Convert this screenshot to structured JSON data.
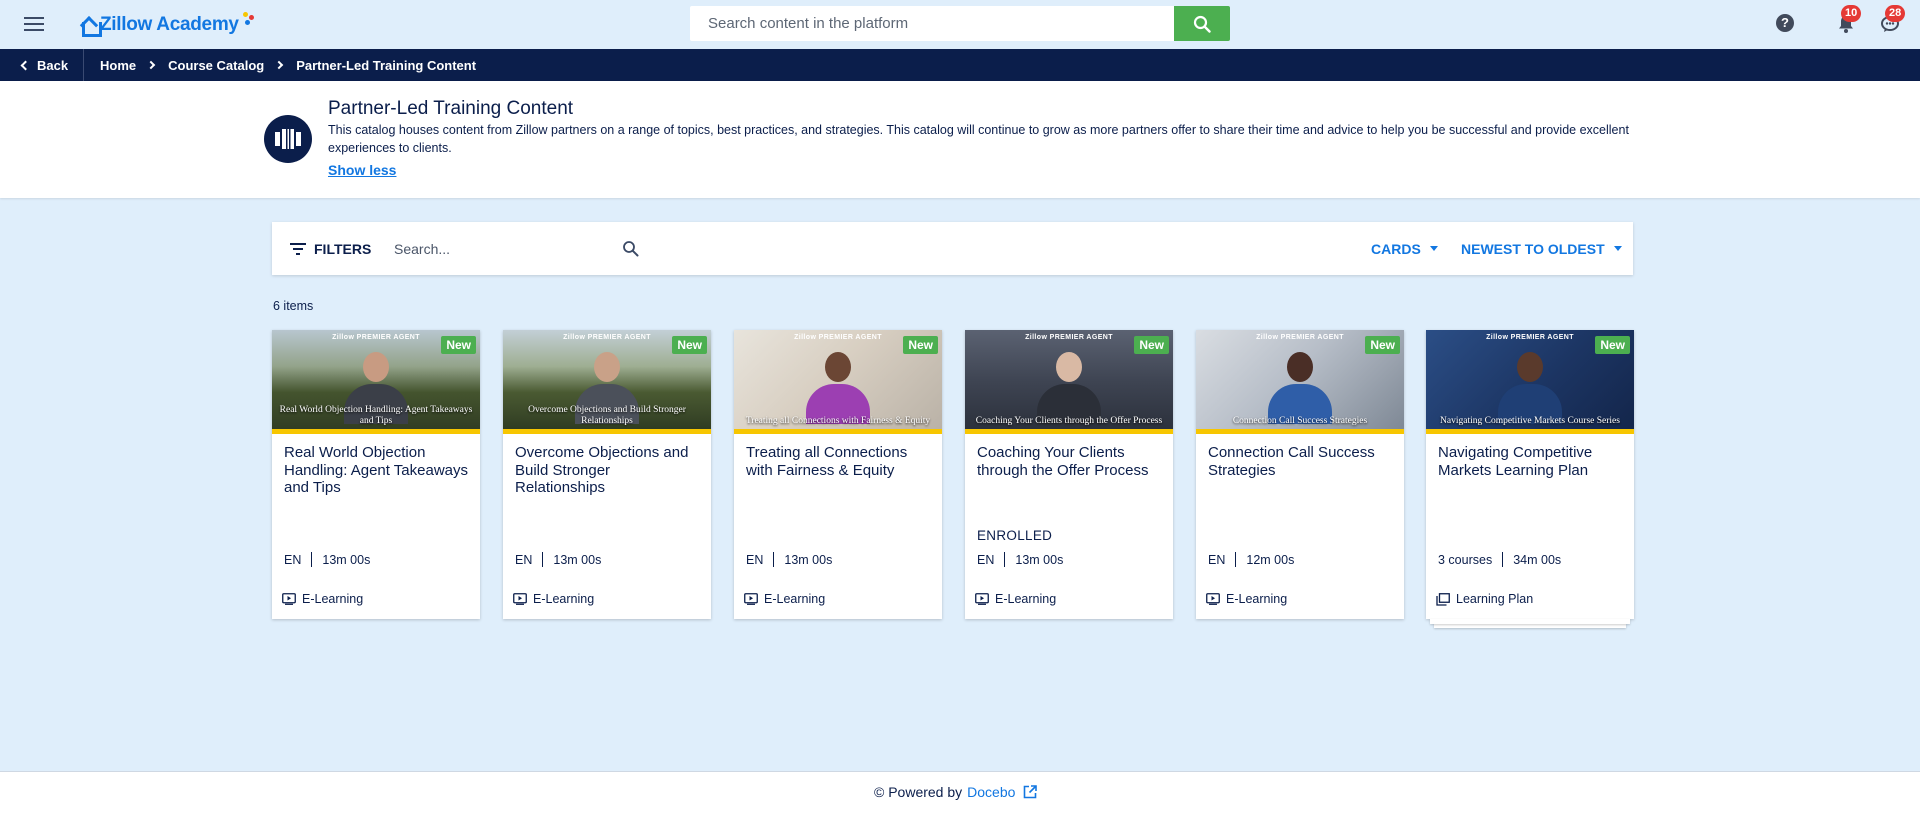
{
  "header": {
    "logo_text": "Zillow Academy",
    "search_placeholder": "Search content in the platform",
    "help_glyph": "?",
    "notifications_count": "10",
    "messages_count": "28",
    "icons": [
      "menu-icon",
      "search-icon",
      "help-icon",
      "bell-icon",
      "chat-icon"
    ]
  },
  "breadcrumb": {
    "back_label": "Back",
    "items": [
      "Home",
      "Course Catalog",
      "Partner-Led Training Content"
    ]
  },
  "catalog": {
    "title": "Partner-Led Training Content",
    "description": "This catalog houses content from Zillow partners on a range of topics, best practices, and strategies. This catalog will continue to grow as more partners offer to share their time and advice to help you be successful and provide excellent experiences to clients.",
    "toggle_label": "Show less"
  },
  "toolbar": {
    "filters_label": "FILTERS",
    "search_placeholder": "Search...",
    "view_label": "CARDS",
    "sort_label": "NEWEST TO OLDEST"
  },
  "results": {
    "count_label": "6 items"
  },
  "cards": [
    {
      "brand": "Zillow PREMIER AGENT",
      "caption": "Real World Objection Handling: Agent Takeaways and Tips",
      "badge": "New",
      "title": "Real World Objection Handling: Agent Takeaways and Tips",
      "meta_left": "EN",
      "meta_right": "13m 00s",
      "status": "",
      "type": "E-Learning"
    },
    {
      "brand": "Zillow PREMIER AGENT",
      "caption": "Overcome Objections and Build Stronger Relationships",
      "badge": "New",
      "title": "Overcome Objections and Build Stronger Relationships",
      "meta_left": "EN",
      "meta_right": "13m 00s",
      "status": "",
      "type": "E-Learning"
    },
    {
      "brand": "Zillow PREMIER AGENT",
      "caption": "Treating all Connections with Fairness & Equity",
      "badge": "New",
      "title": "Treating all Connections with Fairness & Equity",
      "meta_left": "EN",
      "meta_right": "13m 00s",
      "status": "",
      "type": "E-Learning"
    },
    {
      "brand": "Zillow PREMIER AGENT",
      "caption": "Coaching Your Clients through the Offer Process",
      "badge": "New",
      "title": "Coaching Your Clients through the Offer Process",
      "meta_left": "EN",
      "meta_right": "13m 00s",
      "status": "ENROLLED",
      "type": "E-Learning"
    },
    {
      "brand": "Zillow PREMIER AGENT",
      "caption": "Connection Call Success Strategies",
      "badge": "New",
      "title": "Connection Call Success Strategies",
      "meta_left": "EN",
      "meta_right": "12m 00s",
      "status": "",
      "type": "E-Learning"
    },
    {
      "brand": "Zillow PREMIER AGENT",
      "caption": "Navigating Competitive Markets Course Series",
      "badge": "New",
      "title": "Navigating Competitive Markets Learning Plan",
      "meta_left": "3 courses",
      "meta_right": "34m 00s",
      "status": "",
      "type": "Learning Plan"
    }
  ],
  "footer": {
    "prefix": "© Powered by",
    "link_label": "Docebo"
  },
  "colors": {
    "navy": "#0b1e4b",
    "accent_blue": "#1277e1",
    "green": "#4caf50",
    "yellow_bar": "#f7c600",
    "page_bg": "#dfeefb",
    "badge_red": "#e53935"
  }
}
